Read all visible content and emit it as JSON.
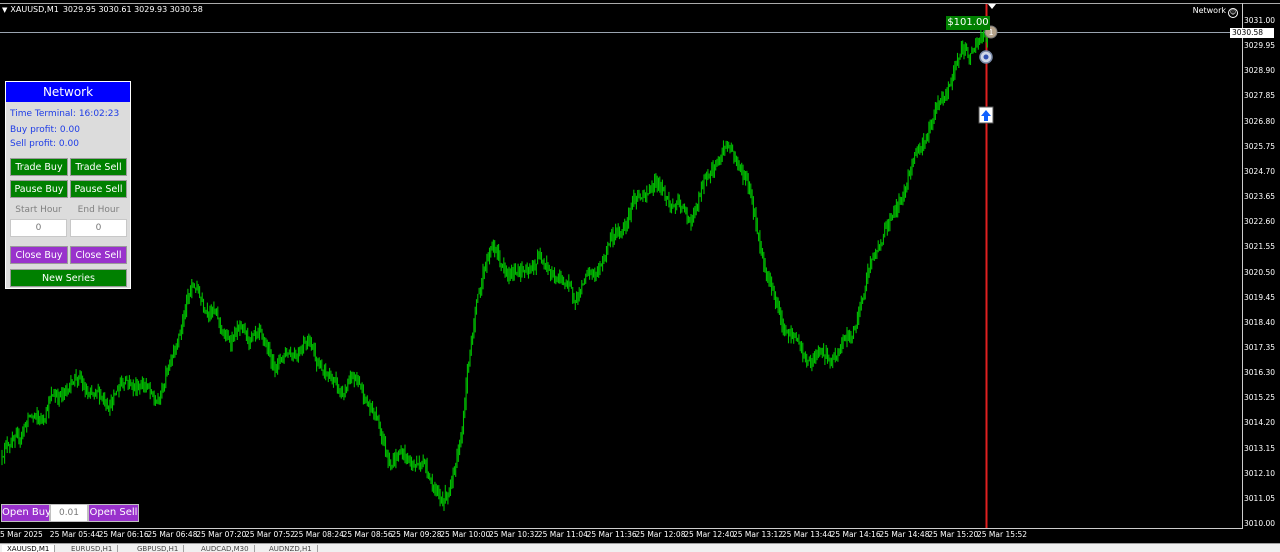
{
  "header": {
    "symbol": "XAUUSD,M1",
    "ohlc": "3029.95 3030.61 3029.93 3030.58",
    "ea_name": "Network"
  },
  "panel": {
    "title": "Network",
    "time_label": "Time Terminal: ",
    "time_value": "16:02:23",
    "buy_profit": "Buy profit: 0.00",
    "sell_profit": "Sell profit: 0.00",
    "trade_buy": "Trade Buy",
    "trade_sell": "Trade Sell",
    "pause_buy": "Pause Buy",
    "pause_sell": "Pause Sell",
    "start_hour_label": "Start Hour",
    "end_hour_label": "End Hour",
    "start_hour_value": "0",
    "end_hour_value": "0",
    "close_buy": "Close Buy",
    "close_sell": "Close Sell",
    "new_series": "New Series"
  },
  "order_bar": {
    "open_buy": "Open Buy",
    "lot": "0.01",
    "open_sell": "Open Sell"
  },
  "profit_tag": "$101.00",
  "current_price": "3030.58",
  "order_badge": "1",
  "price_scale": [
    "3031.00",
    "3029.95",
    "3028.90",
    "3027.85",
    "3026.80",
    "3025.75",
    "3024.70",
    "3023.65",
    "3022.60",
    "3021.55",
    "3020.50",
    "3019.45",
    "3018.40",
    "3017.35",
    "3016.30",
    "3015.25",
    "3014.20",
    "3013.15",
    "3012.10",
    "3011.05",
    "3010.00"
  ],
  "time_scale": [
    "5 Mar 2025",
    "25 Mar 05:44",
    "25 Mar 06:16",
    "25 Mar 06:48",
    "25 Mar 07:20",
    "25 Mar 07:52",
    "25 Mar 08:24",
    "25 Mar 08:56",
    "25 Mar 09:28",
    "25 Mar 10:00",
    "25 Mar 10:32",
    "25 Mar 11:04",
    "25 Mar 11:36",
    "25 Mar 12:08",
    "25 Mar 12:40",
    "25 Mar 13:12",
    "25 Mar 13:44",
    "25 Mar 14:16",
    "25 Mar 14:48",
    "25 Mar 15:20",
    "25 Mar 15:52"
  ],
  "tabs": [
    "XAUUSD,M1",
    "EURUSD,H1",
    "GBPUSD,H1",
    "AUDCAD,M30",
    "AUDNZD,H1"
  ],
  "colors": {
    "candle": "#00c000",
    "panel_title": "#0000ff",
    "button_green": "#008000",
    "button_purple": "#9932cc",
    "cursor_line": "#e02020"
  },
  "chart_data": {
    "type": "candlestick",
    "symbol": "XAUUSD",
    "timeframe": "M1",
    "ylim": [
      3010.0,
      3031.0
    ],
    "x": [
      "25 Mar 05:12",
      "25 Mar 05:44",
      "25 Mar 06:16",
      "25 Mar 06:48",
      "25 Mar 07:20",
      "25 Mar 07:52",
      "25 Mar 08:24",
      "25 Mar 08:56",
      "25 Mar 09:28",
      "25 Mar 10:00",
      "25 Mar 10:32",
      "25 Mar 11:04",
      "25 Mar 11:36",
      "25 Mar 12:08",
      "25 Mar 12:40",
      "25 Mar 13:12",
      "25 Mar 13:44",
      "25 Mar 14:16",
      "25 Mar 14:48",
      "25 Mar 15:20",
      "25 Mar 15:52"
    ],
    "values": [
      3012.8,
      3015.4,
      3015.6,
      3015.5,
      3019.4,
      3017.5,
      3017.2,
      3016.0,
      3013.2,
      3011.2,
      3021.1,
      3020.5,
      3020.0,
      3023.8,
      3023.3,
      3025.6,
      3018.0,
      3016.6,
      3021.8,
      3026.9,
      3030.5
    ],
    "current_price": 3030.58,
    "profit": "$101.00"
  }
}
